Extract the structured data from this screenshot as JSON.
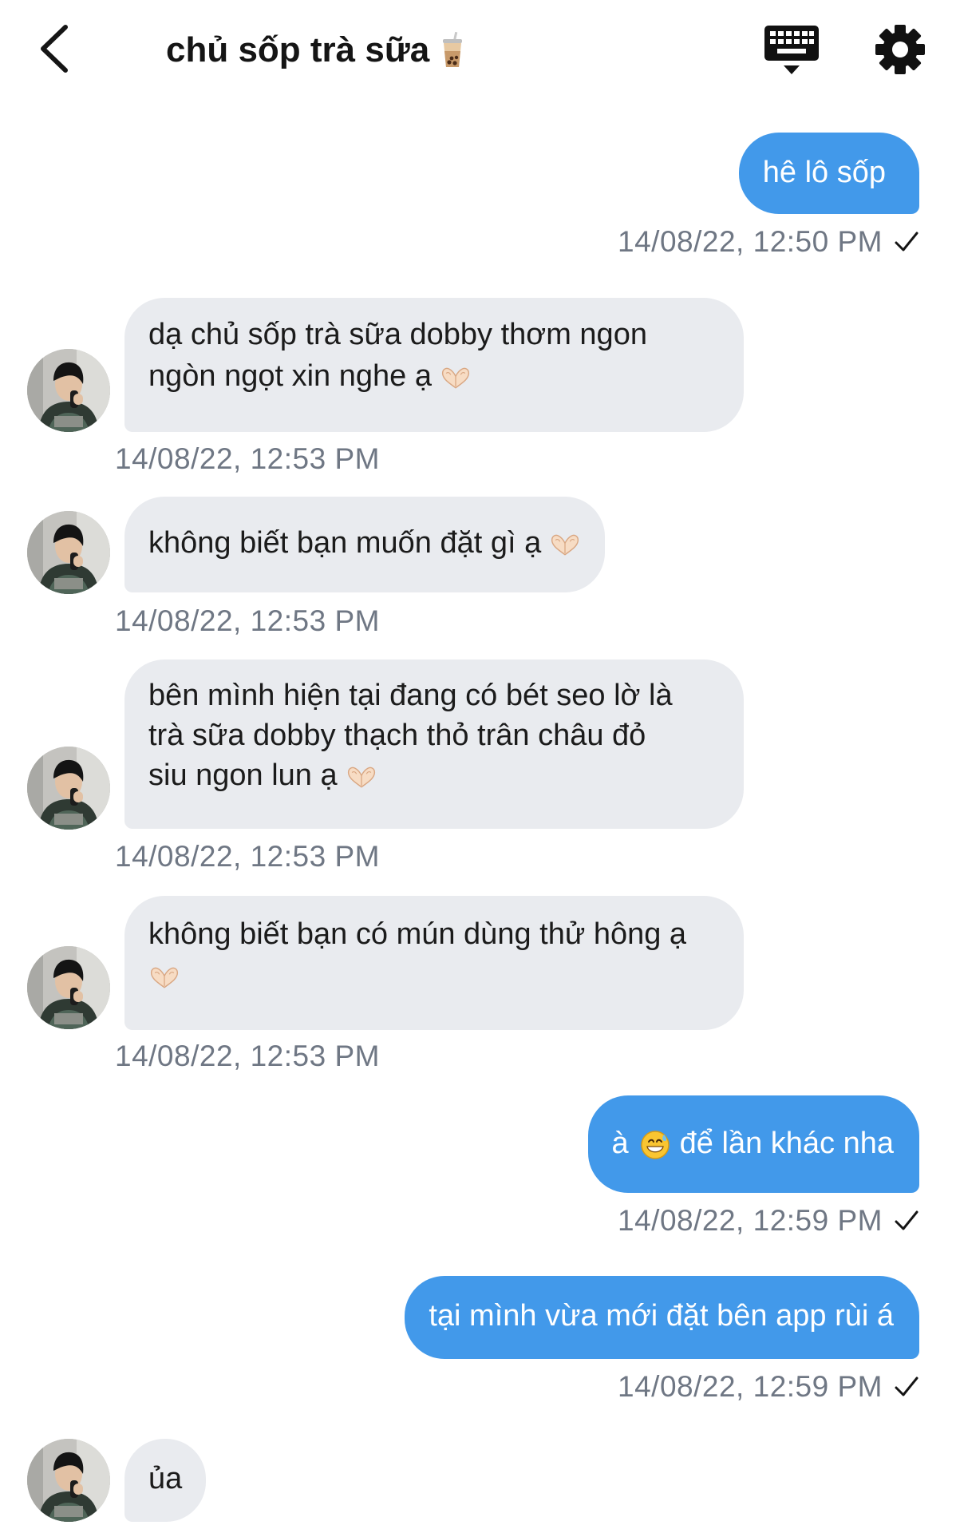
{
  "header": {
    "back_icon": "chevron-left-icon",
    "title": "chủ sốp trà sữa",
    "title_emoji": "bubble-tea-icon",
    "keyboard_icon": "keyboard-icon",
    "settings_icon": "gear-icon"
  },
  "colors": {
    "outgoing_bubble": "#4299ea",
    "incoming_bubble": "#e9ebef",
    "timestamp": "#6f7784"
  },
  "messages": [
    {
      "direction": "out",
      "lines": [
        "hê lô sốp"
      ],
      "time": "14/08/22, 12:50 PM",
      "status": "sent-check"
    },
    {
      "direction": "in",
      "lines": [
        "dạ chủ sốp trà sữa dobby thơm ngon",
        "ngòn ngọt xin nghe ạ"
      ],
      "emoji": "heart-hands",
      "time": "14/08/22, 12:53 PM"
    },
    {
      "direction": "in",
      "lines": [
        "không biết bạn muốn đặt gì ạ"
      ],
      "emoji": "heart-hands",
      "time": "14/08/22, 12:53 PM"
    },
    {
      "direction": "in",
      "lines": [
        "bên mình hiện tại đang có bét seo lờ là",
        "trà sữa dobby thạch thỏ trân châu đỏ",
        "siu ngon lun ạ"
      ],
      "emoji": "heart-hands",
      "time": "14/08/22, 12:53 PM"
    },
    {
      "direction": "in",
      "lines": [
        "không biết bạn có mún dùng thử hông ạ"
      ],
      "emoji": "heart-hands",
      "time": "14/08/22, 12:53 PM"
    },
    {
      "direction": "out",
      "lines": [
        "à",
        "để lần khác nha"
      ],
      "emoji": "grinning-sweat",
      "time": "14/08/22, 12:59 PM",
      "status": "sent-check"
    },
    {
      "direction": "out",
      "lines": [
        "tại mình vừa mới đặt bên app rùi á"
      ],
      "time": "14/08/22, 12:59 PM",
      "status": "sent-check"
    },
    {
      "direction": "in",
      "lines": [
        "ủa"
      ]
    }
  ]
}
